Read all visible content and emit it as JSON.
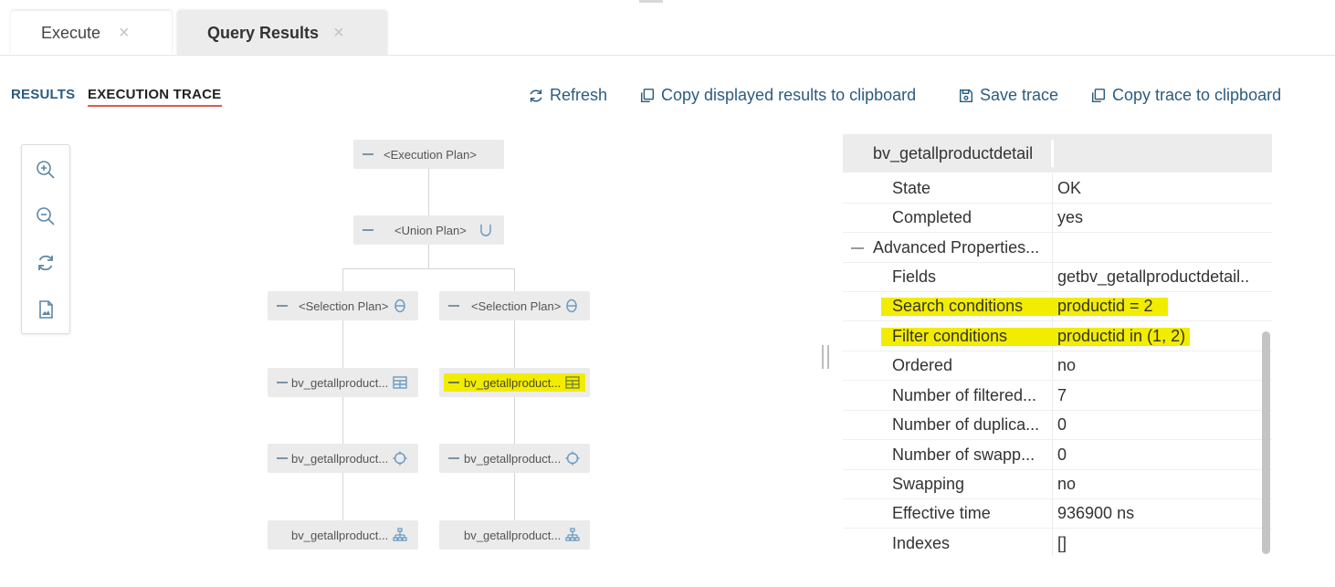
{
  "tabs": [
    {
      "label": "Execute",
      "close": "×"
    },
    {
      "label": "Query Results",
      "close": "×"
    }
  ],
  "subtabs": {
    "results": "RESULTS",
    "trace": "EXECUTION TRACE"
  },
  "actions": {
    "refresh": "Refresh",
    "copy_displayed": "Copy displayed results to clipboard",
    "save_trace": "Save trace",
    "copy_trace": "Copy trace to clipboard"
  },
  "zoom_tools": [
    "zoom-in-icon",
    "zoom-out-icon",
    "reset-view-icon",
    "export-image-icon"
  ],
  "plan": {
    "root": "<Execution Plan>",
    "union": "<Union Plan>",
    "selection_left": "<Selection Plan>",
    "selection_right": "<Selection Plan>",
    "view_left": "bv_getallproduct...",
    "view_right": "bv_getallproduct...",
    "join_left": "bv_getallproduct...",
    "join_right": "bv_getallproduct...",
    "base_left": "bv_getallproduct...",
    "base_right": "bv_getallproduct..."
  },
  "highlight_color": "#f2ec00",
  "accent_color": "#2b5c7f",
  "properties": {
    "title": "bv_getallproductdetail",
    "rows": [
      {
        "key": "State",
        "value": "OK"
      },
      {
        "key": "Completed",
        "value": "yes"
      },
      {
        "key": "Advanced Properties...",
        "value": ""
      },
      {
        "key": "Fields",
        "value": "getbv_getallproductdetail.."
      },
      {
        "key": "Search conditions",
        "value": "productid = 2"
      },
      {
        "key": "Filter conditions",
        "value": "productid in (1, 2)"
      },
      {
        "key": "Ordered",
        "value": "no"
      },
      {
        "key": "Number of filtered...",
        "value": "7"
      },
      {
        "key": "Number of duplica...",
        "value": "0"
      },
      {
        "key": "Number of swapp...",
        "value": "0"
      },
      {
        "key": "Swapping",
        "value": "no"
      },
      {
        "key": "Effective time",
        "value": "936900 ns"
      },
      {
        "key": "Indexes",
        "value": "[]"
      }
    ]
  }
}
